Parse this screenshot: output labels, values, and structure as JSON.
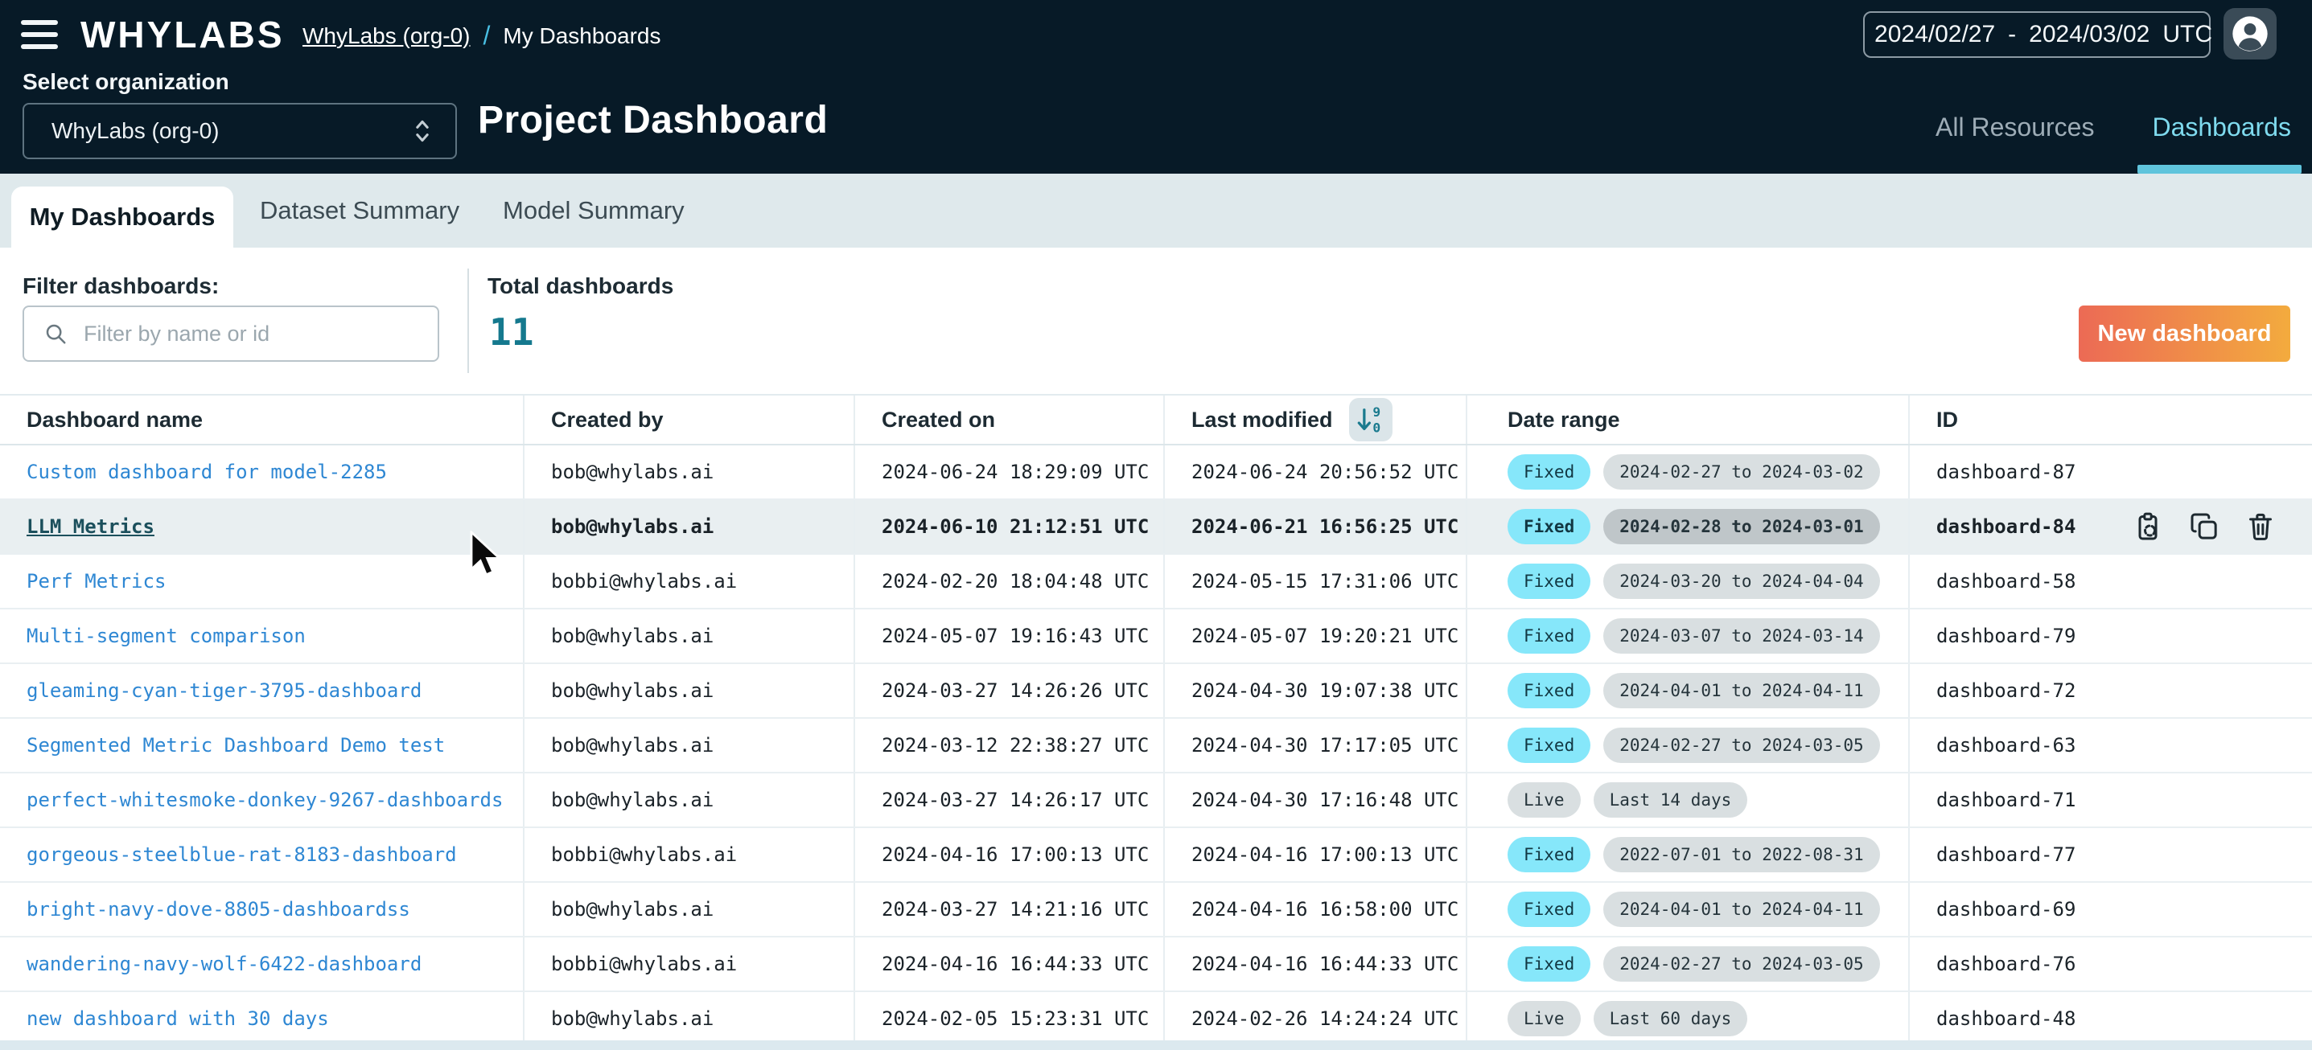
{
  "header": {
    "logo": "WHYLABS",
    "breadcrumb": {
      "org": "WhyLabs (org-0)",
      "separator": "/",
      "current": "My Dashboards"
    },
    "date_range_picker": {
      "start": "2024/02/27",
      "separator": "-",
      "end": "2024/03/02",
      "timezone": "UTC"
    },
    "org_selector": {
      "label": "Select organization",
      "value": "WhyLabs (org-0)"
    },
    "page_title": "Project Dashboard",
    "nav_tabs": [
      {
        "label": "All Resources",
        "active": false
      },
      {
        "label": "Dashboards",
        "active": true
      }
    ],
    "icons": [
      "menu-icon",
      "calendar-icon",
      "user-avatar-icon",
      "select-chevron-icon"
    ]
  },
  "tabs": [
    {
      "label": "My Dashboards",
      "active": true
    },
    {
      "label": "Dataset Summary",
      "active": false
    },
    {
      "label": "Model Summary",
      "active": false
    }
  ],
  "filter": {
    "label": "Filter dashboards:",
    "placeholder": "Filter by name or id",
    "value": "",
    "icon": "search-icon"
  },
  "summary": {
    "label": "Total dashboards",
    "count": "11"
  },
  "toolbar": {
    "new_dashboard_label": "New dashboard"
  },
  "table": {
    "columns": [
      "Dashboard name",
      "Created by",
      "Created on",
      "Last modified",
      "Date range",
      "ID"
    ],
    "sort": {
      "column": "Last modified",
      "direction": "descending",
      "icon_digits": {
        "top": "9",
        "bottom": "0"
      }
    },
    "row_action_icons": [
      "copy-id-icon",
      "duplicate-icon",
      "delete-icon"
    ],
    "rows": [
      {
        "name": "Custom dashboard for model-2285",
        "created_by": "bob@whylabs.ai",
        "created_on": "2024-06-24 18:29:09 UTC",
        "last_modified": "2024-06-24 20:56:52 UTC",
        "range_type": "Fixed",
        "range": "2024-02-27 to 2024-03-02",
        "id": "dashboard-87",
        "hovered": false
      },
      {
        "name": "LLM Metrics",
        "created_by": "bob@whylabs.ai",
        "created_on": "2024-06-10 21:12:51 UTC",
        "last_modified": "2024-06-21 16:56:25 UTC",
        "range_type": "Fixed",
        "range": "2024-02-28 to 2024-03-01",
        "id": "dashboard-84",
        "hovered": true
      },
      {
        "name": "Perf Metrics",
        "created_by": "bobbi@whylabs.ai",
        "created_on": "2024-02-20 18:04:48 UTC",
        "last_modified": "2024-05-15 17:31:06 UTC",
        "range_type": "Fixed",
        "range": "2024-03-20 to 2024-04-04",
        "id": "dashboard-58",
        "hovered": false
      },
      {
        "name": "Multi-segment comparison",
        "created_by": "bob@whylabs.ai",
        "created_on": "2024-05-07 19:16:43 UTC",
        "last_modified": "2024-05-07 19:20:21 UTC",
        "range_type": "Fixed",
        "range": "2024-03-07 to 2024-03-14",
        "id": "dashboard-79",
        "hovered": false
      },
      {
        "name": "gleaming-cyan-tiger-3795-dashboard",
        "created_by": "bob@whylabs.ai",
        "created_on": "2024-03-27 14:26:26 UTC",
        "last_modified": "2024-04-30 19:07:38 UTC",
        "range_type": "Fixed",
        "range": "2024-04-01 to 2024-04-11",
        "id": "dashboard-72",
        "hovered": false
      },
      {
        "name": "Segmented Metric Dashboard Demo test",
        "created_by": "bob@whylabs.ai",
        "created_on": "2024-03-12 22:38:27 UTC",
        "last_modified": "2024-04-30 17:17:05 UTC",
        "range_type": "Fixed",
        "range": "2024-02-27 to 2024-03-05",
        "id": "dashboard-63",
        "hovered": false
      },
      {
        "name": "perfect-whitesmoke-donkey-9267-dashboards",
        "created_by": "bob@whylabs.ai",
        "created_on": "2024-03-27 14:26:17 UTC",
        "last_modified": "2024-04-30 17:16:48 UTC",
        "range_type": "Live",
        "range": "Last 14 days",
        "id": "dashboard-71",
        "hovered": false
      },
      {
        "name": "gorgeous-steelblue-rat-8183-dashboard",
        "created_by": "bobbi@whylabs.ai",
        "created_on": "2024-04-16 17:00:13 UTC",
        "last_modified": "2024-04-16 17:00:13 UTC",
        "range_type": "Fixed",
        "range": "2022-07-01 to 2022-08-31",
        "id": "dashboard-77",
        "hovered": false
      },
      {
        "name": "bright-navy-dove-8805-dashboardss",
        "created_by": "bob@whylabs.ai",
        "created_on": "2024-03-27 14:21:16 UTC",
        "last_modified": "2024-04-16 16:58:00 UTC",
        "range_type": "Fixed",
        "range": "2024-04-01 to 2024-04-11",
        "id": "dashboard-69",
        "hovered": false
      },
      {
        "name": "wandering-navy-wolf-6422-dashboard",
        "created_by": "bobbi@whylabs.ai",
        "created_on": "2024-04-16 16:44:33 UTC",
        "last_modified": "2024-04-16 16:44:33 UTC",
        "range_type": "Fixed",
        "range": "2024-02-27 to 2024-03-05",
        "id": "dashboard-76",
        "hovered": false
      },
      {
        "name": "new dashboard with 30 days",
        "created_by": "bob@whylabs.ai",
        "created_on": "2024-02-05 15:23:31 UTC",
        "last_modified": "2024-02-26 14:24:24 UTC",
        "range_type": "Live",
        "range": "Last 60 days",
        "id": "dashboard-48",
        "hovered": false
      }
    ]
  },
  "colors": {
    "topbar_bg": "#071A27",
    "accent_cyan": "#5FC4DC",
    "link_blue": "#2E87D3",
    "hover_link_teal": "#1B4F5C",
    "badge_fixed": "#86E7FA",
    "badge_grey": "#D9DFE1",
    "button_gradient": [
      "#EC6A55",
      "#F3AB3E"
    ],
    "count_teal": "#15798E",
    "tabstrip_bg": "#DFE9EC"
  }
}
